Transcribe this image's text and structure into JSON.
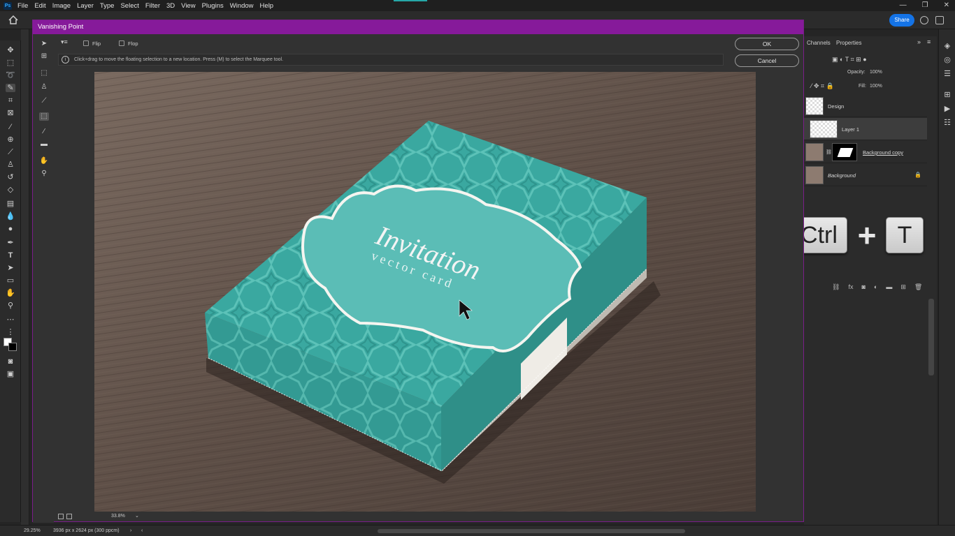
{
  "menu": {
    "app_icon": "Ps",
    "items": [
      "File",
      "Edit",
      "Image",
      "Layer",
      "Type",
      "Select",
      "Filter",
      "3D",
      "View",
      "Plugins",
      "Window",
      "Help"
    ]
  },
  "optionsbar": {
    "share_label": "Share"
  },
  "dialog": {
    "title": "Vanishing Point",
    "flip_label": "Flip",
    "flop_label": "Flop",
    "hint": "Click+drag to move the floating selection to a new location. Press (M) to select the Marquee tool.",
    "ok_label": "OK",
    "cancel_label": "Cancel",
    "zoom": "33.8%"
  },
  "canvas": {
    "box_title": "Invitation",
    "box_subtitle": "vector card"
  },
  "layers_panel": {
    "tab_channels": "Channels",
    "tab_properties": "Properties",
    "opacity_label": "Opacity:",
    "opacity_value": "100%",
    "fill_label": "Fill:",
    "fill_value": "100%",
    "layers": [
      "Design",
      "Layer 1",
      "Background copy",
      "Background"
    ]
  },
  "shortcut": {
    "key1": "Ctrl",
    "plus": "+",
    "key2": "T"
  },
  "status": {
    "zoom": "29.25%",
    "doc_info": "3936 px x 2624 px (300 ppcm)"
  },
  "colors": {
    "dialog_titlebar": "#861a9a",
    "share_button": "#1473e6",
    "box_teal": "#3aa8a0"
  }
}
